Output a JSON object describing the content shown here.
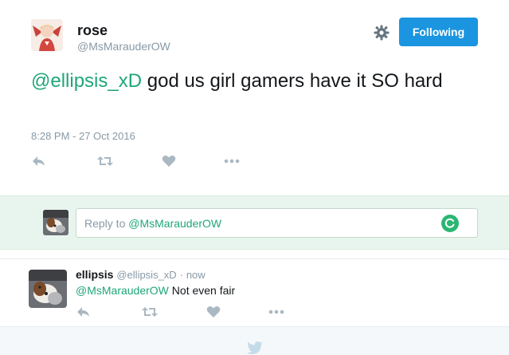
{
  "tweet": {
    "author_name": "rose",
    "author_handle": "@MsMarauderOW",
    "follow_label": "Following",
    "text_mention": "@ellipsis_xD",
    "text_body": " god us girl gamers have it SO hard",
    "timestamp": "8:28 PM - 27 Oct 2016",
    "icons": [
      "reply-icon",
      "retweet-icon",
      "like-icon",
      "more-icon",
      "gear-icon"
    ]
  },
  "reply_box": {
    "prefix": "Reply to ",
    "mention": "@MsMarauderOW"
  },
  "reply": {
    "author_name": "ellipsis",
    "author_handle": "@ellipsis_xD",
    "separator": "·",
    "time": "now",
    "mention": "@MsMarauderOW",
    "text": " Not even fair"
  },
  "colors": {
    "accent": "#1fa67a",
    "follow_button": "#1b95e0",
    "muted": "#8899a6",
    "reply_bg": "#e8f5ee"
  }
}
